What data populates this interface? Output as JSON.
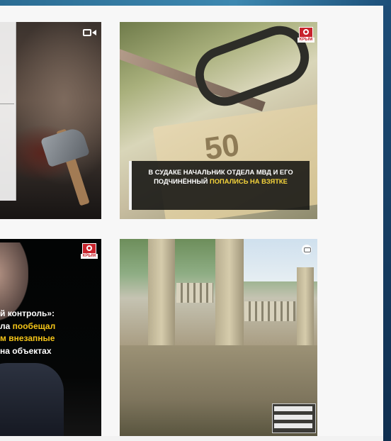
{
  "posts": [
    {
      "type": "video",
      "icon": "video-camera-icon"
    },
    {
      "type": "image",
      "logo_text": "КРЫМ",
      "caption_before": "В СУДАКЕ НАЧАЛЬНИК ОТДЕЛА МВД И ЕГО ПОДЧИНЁННЫЙ ",
      "caption_highlight": "ПОПАЛИСЬ НА ВЗЯТКЕ"
    },
    {
      "type": "image",
      "logo_text": "КРЫМ",
      "quote_lines": [
        {
          "before": "й контроль»:",
          "highlight": ""
        },
        {
          "before": "ла ",
          "highlight": "пообещал"
        },
        {
          "before": "",
          "highlight": "м внезапные"
        },
        {
          "before": "на объектах",
          "highlight": ""
        }
      ]
    },
    {
      "type": "carousel",
      "icon": "multiple-images-icon"
    }
  ],
  "colors": {
    "highlight": "#f5d43b",
    "krym_red": "#c8232c",
    "page_bg": "#f7f7f7"
  }
}
